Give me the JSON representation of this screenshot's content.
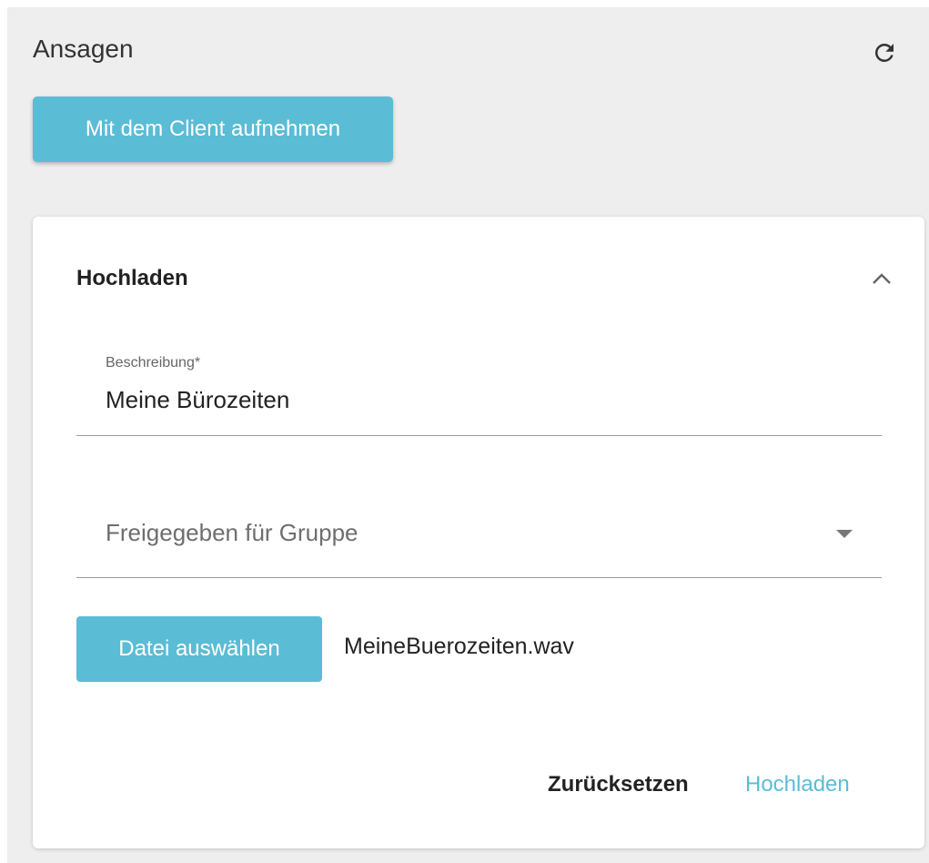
{
  "header": {
    "title": "Ansagen",
    "refresh_icon": "refresh-icon"
  },
  "actions": {
    "record_label": "Mit dem Client aufnehmen"
  },
  "upload_card": {
    "title": "Hochladen",
    "collapse_icon": "chevron-up-icon",
    "description": {
      "label": "Beschreibung*",
      "value": "Meine Bürozeiten"
    },
    "group_select": {
      "placeholder": "Freigegeben für Gruppe",
      "icon": "dropdown-arrow-icon"
    },
    "file": {
      "button_label": "Datei auswählen",
      "selected_name": "MeineBuerozeiten.wav"
    },
    "footer": {
      "reset_label": "Zurücksetzen",
      "upload_label": "Hochladen"
    }
  },
  "colors": {
    "accent": "#5bbcd6",
    "panel_background": "#eeeeee",
    "card_background": "#ffffff",
    "text_primary": "#222222"
  }
}
